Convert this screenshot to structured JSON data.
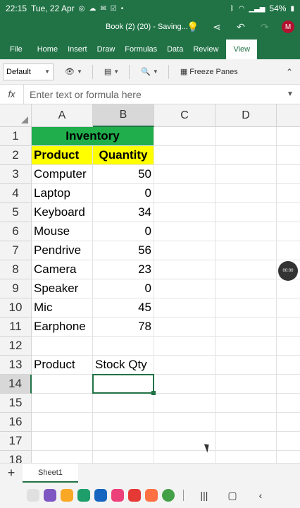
{
  "status_bar": {
    "time": "22:15",
    "date": "Tue, 22 Apr",
    "battery": "54%"
  },
  "title_bar": {
    "doc_title": "Book (2) (20) - Saving...",
    "avatar_initial": "M"
  },
  "ribbon": {
    "tabs": [
      "File",
      "Home",
      "Insert",
      "Draw",
      "Formulas",
      "Data",
      "Review",
      "View"
    ],
    "active_tab": "View"
  },
  "toolbar": {
    "sheet_view": "Default",
    "freeze_panes": "Freeze Panes"
  },
  "formula_bar": {
    "fx": "fx",
    "placeholder": "Enter text or formula here"
  },
  "columns": [
    "A",
    "B",
    "C",
    "D"
  ],
  "rows": [
    "1",
    "2",
    "3",
    "4",
    "5",
    "6",
    "7",
    "8",
    "9",
    "10",
    "11",
    "12",
    "13",
    "14",
    "15",
    "16",
    "17",
    "18"
  ],
  "cells": {
    "title": "Inventory",
    "header_product": "Product",
    "header_quantity": "Quantity",
    "items": [
      {
        "product": "Computer",
        "qty": "50"
      },
      {
        "product": "Laptop",
        "qty": "0"
      },
      {
        "product": "Keyboard",
        "qty": "34"
      },
      {
        "product": "Mouse",
        "qty": "0"
      },
      {
        "product": "Pendrive",
        "qty": "56"
      },
      {
        "product": "Camera",
        "qty": "23"
      },
      {
        "product": "Speaker",
        "qty": "0"
      },
      {
        "product": "Mic",
        "qty": "45"
      },
      {
        "product": "Earphone",
        "qty": "78"
      }
    ],
    "a13": "Product",
    "b13": "Stock Qty"
  },
  "recording_badge": "00:00",
  "sheet_tabs": [
    "Sheet1"
  ],
  "colors": {
    "accent": "#217346",
    "title_fill": "#1fae4b",
    "header_fill": "#ffff00"
  }
}
